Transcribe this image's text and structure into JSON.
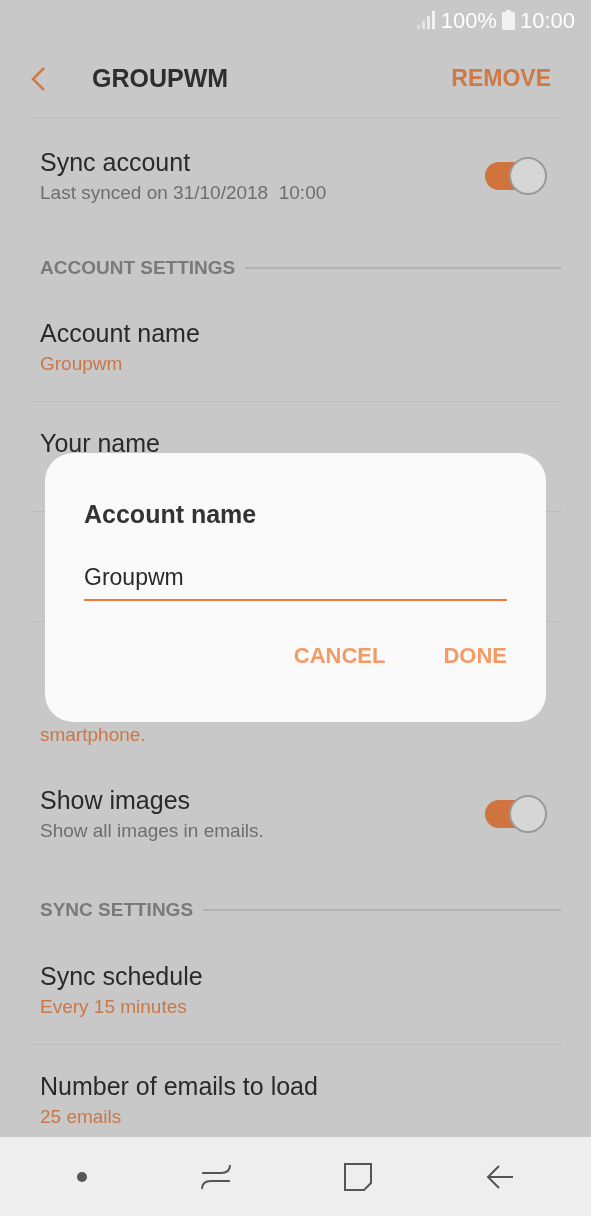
{
  "status_bar": {
    "battery": "100%",
    "time": "10:00"
  },
  "header": {
    "title": "GROUPWM",
    "action": "REMOVE"
  },
  "items": [
    {
      "kind": "toggle",
      "title": "Sync account",
      "subtitle_lines": [
        "Last synced on 31/10/2018  10:00"
      ],
      "on": true
    },
    {
      "kind": "section",
      "title": "ACCOUNT SETTINGS"
    },
    {
      "kind": "value",
      "title": "Account name",
      "subtitle_lines": [
        "Groupwm"
      ]
    },
    {
      "kind": "value",
      "title": "Your name"
    },
    {
      "kind": "covered"
    },
    {
      "kind": "covered",
      "subtitle_lines": [
        "smartphone."
      ]
    },
    {
      "kind": "toggle",
      "title": "Show images",
      "subtitle_lines": [
        "Show all images in emails."
      ],
      "on": true
    },
    {
      "kind": "section",
      "title": "SYNC SETTINGS"
    },
    {
      "kind": "value",
      "title": "Sync schedule",
      "subtitle_lines": [
        "Every 15 minutes"
      ]
    },
    {
      "kind": "value",
      "title": "Number of emails to load",
      "subtitle_lines": [
        "25 emails"
      ]
    }
  ],
  "dialog": {
    "title": "Account name",
    "value": "Groupwm",
    "buttons": [
      "CANCEL",
      "DONE"
    ]
  }
}
